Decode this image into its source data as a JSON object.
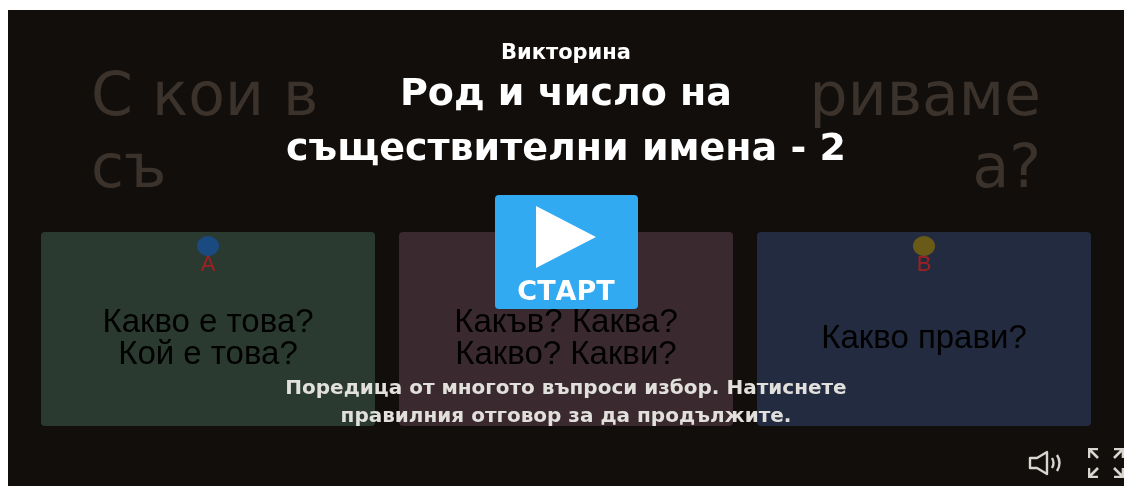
{
  "slide": {
    "heading_line_1_visible_parts": [
      "С кои в",
      "риваме"
    ],
    "heading_line_2_visible_parts": [
      "съ",
      "а?"
    ],
    "cards": [
      {
        "letter": "А",
        "pin": {
          "color": "#1a4a80"
        },
        "lines": [
          "Какво е това?",
          "Кой е това?"
        ],
        "color": "#2a3a31"
      },
      {
        "lines": [
          "Какъв? Каква?",
          "Какво? Какви?"
        ],
        "color": "#3a2a2f"
      },
      {
        "letter": "В",
        "pin": {
          "color": "#6a5a18"
        },
        "lines": [
          "Какво прави?"
        ],
        "color": "#222b3f"
      }
    ]
  },
  "overlay": {
    "kicker": "Викторина",
    "title_lines": [
      "Род и число на",
      "съществителни имена - 2"
    ],
    "start_button": "СТАРТ",
    "description": "Поредица от многото въпроси избор. Натиснете правилния отговор за да продължите."
  },
  "controls": [
    {
      "kind": "volume"
    },
    {
      "kind": "fullscreen"
    }
  ]
}
